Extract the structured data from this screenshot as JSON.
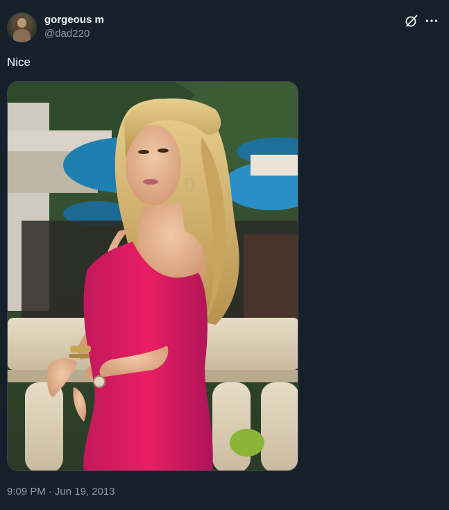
{
  "tweet": {
    "author": {
      "display_name": "gorgeous m",
      "handle": "@dad220",
      "avatar_icon": "avatar-image"
    },
    "actions": {
      "grok_icon": "grok-icon",
      "more_icon": "more-options-icon"
    },
    "text": "Nice",
    "media": {
      "type": "photo"
    },
    "time": "9:09 PM",
    "separator": "·",
    "date": "Jun 19, 2013"
  },
  "colors": {
    "background": "#15202b",
    "primary_text": "#f7f9f9",
    "secondary_text": "#8b98a5",
    "border": "#38444d",
    "dress": "#d81b60"
  }
}
